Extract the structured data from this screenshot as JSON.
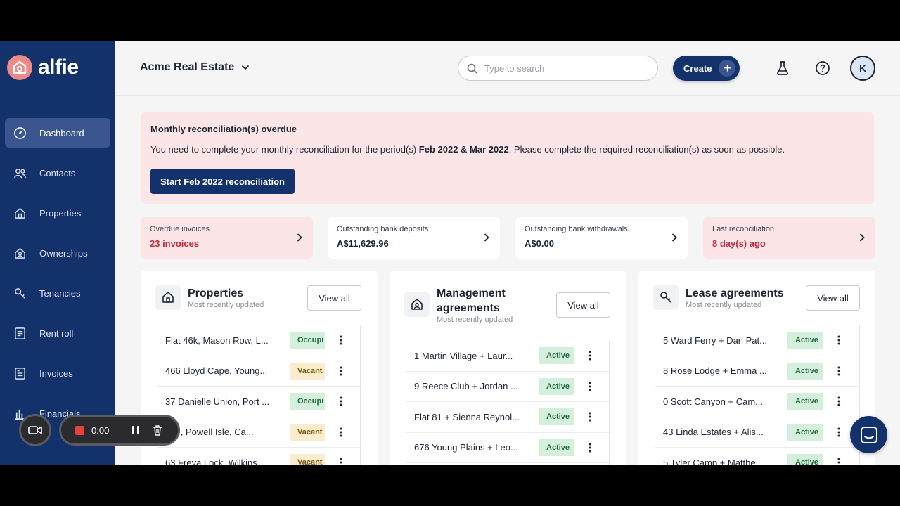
{
  "app": {
    "logo_text": "alfie"
  },
  "sidebar": {
    "items": [
      {
        "label": "Dashboard",
        "icon": "dashboard-icon",
        "active": true
      },
      {
        "label": "Contacts",
        "icon": "contacts-icon"
      },
      {
        "label": "Properties",
        "icon": "properties-icon"
      },
      {
        "label": "Ownerships",
        "icon": "ownerships-icon"
      },
      {
        "label": "Tenancies",
        "icon": "tenancies-icon"
      },
      {
        "label": "Rent roll",
        "icon": "rent-roll-icon"
      },
      {
        "label": "Invoices",
        "icon": "invoices-icon"
      },
      {
        "label": "Financials",
        "icon": "financials-icon"
      }
    ]
  },
  "header": {
    "org_name": "Acme Real Estate",
    "search_placeholder": "Type to search",
    "create_label": "Create",
    "avatar_initial": "K"
  },
  "alert": {
    "title": "Monthly reconciliation(s) overdue",
    "msg_prefix": "You need to complete your monthly reconciliation for the period(s) ",
    "msg_periods": "Feb 2022 & Mar 2022",
    "msg_suffix": ". Please complete the required reconciliation(s) as soon as possible.",
    "button_label": "Start Feb 2022 reconciliation"
  },
  "stats": [
    {
      "label": "Overdue invoices",
      "value": "23 invoices",
      "status": "warning"
    },
    {
      "label": "Outstanding bank deposits",
      "value": "A$11,629.96",
      "status": "normal"
    },
    {
      "label": "Outstanding bank withdrawals",
      "value": "A$0.00",
      "status": "normal"
    },
    {
      "label": "Last reconciliation",
      "value": "8 day(s) ago",
      "status": "warning"
    }
  ],
  "cards": {
    "properties": {
      "title": "Properties",
      "subtitle": "Most recently updated",
      "view_all": "View all",
      "rows": [
        {
          "text": "Flat 46k, Mason Row, L...",
          "badge": "Occupi"
        },
        {
          "text": "466 Lloyd Cape, Young...",
          "badge": "Vacant"
        },
        {
          "text": "37 Danielle Union, Port ...",
          "badge": "Occupi"
        },
        {
          "text": "27e, Powell Isle, Ca...",
          "badge": "Vacant"
        },
        {
          "text": "63 Freya Lock, Wilkins",
          "badge": "Vacant"
        }
      ]
    },
    "management": {
      "title_line1": "Management",
      "title_line2": "agreements",
      "subtitle": "Most recently updated",
      "view_all": "View all",
      "rows": [
        {
          "text": "1 Martin Village + Laur...",
          "badge": "Active"
        },
        {
          "text": "9 Reece Club + Jordan ...",
          "badge": "Active"
        },
        {
          "text": "Flat 81 + Sienna Reynol...",
          "badge": "Active"
        },
        {
          "text": "676 Young Plains + Leo...",
          "badge": "Active"
        }
      ]
    },
    "lease": {
      "title": "Lease agreements",
      "subtitle": "Most recently updated",
      "view_all": "View all",
      "rows": [
        {
          "text": "5 Ward Ferry + Dan Pat...",
          "badge": "Active"
        },
        {
          "text": "8 Rose Lodge + Emma ...",
          "badge": "Active"
        },
        {
          "text": "0 Scott Canyon + Cam...",
          "badge": "Active"
        },
        {
          "text": "43 Linda Estates + Alis...",
          "badge": "Active"
        },
        {
          "text": "5 Tyler Camp + Matthe...",
          "badge": "Active"
        }
      ]
    }
  },
  "recorder": {
    "time": "0:00"
  },
  "colors": {
    "sidebar": "#13316a",
    "accent": "#13316a",
    "warning_text": "#c42a3a",
    "alert_bg": "#fbe5e6"
  }
}
